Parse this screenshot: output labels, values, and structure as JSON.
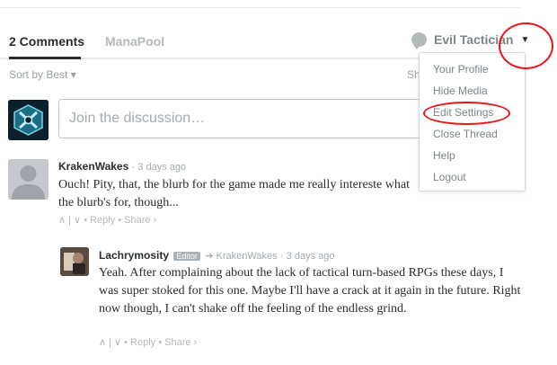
{
  "tabs": [
    {
      "label": "2 Comments"
    },
    {
      "label": "ManaPool"
    }
  ],
  "user": {
    "name": "Evil Tactician"
  },
  "sort": {
    "label": "Sort by Best ▾",
    "share_partial": "Sh"
  },
  "compose": {
    "placeholder": "Join the discussion…"
  },
  "menu": {
    "items": [
      {
        "label": "Your Profile"
      },
      {
        "label": "Hide Media"
      },
      {
        "label": "Edit Settings"
      },
      {
        "label": "Close Thread"
      },
      {
        "label": "Help"
      },
      {
        "label": "Logout"
      }
    ]
  },
  "comments": [
    {
      "author": "KrakenWakes",
      "time": "3 days ago",
      "body": "Ouch! Pity, that, the blurb for the game made me really intereste what the blurb's for, though...",
      "actions": "∧ | ∨ • Reply • Share ›"
    },
    {
      "author": "Lachrymosity",
      "badge": "Editor",
      "reply_to": "➔ KrakenWakes",
      "time": "3 days ago",
      "body": "Yeah. After complaining about the lack of tactical turn-based RPGs these days, I was super stoked for this one. Maybe I'll have a crack at it again in the future. Right now though, I can't shake off the feeling of the endless grind.",
      "actions": "∧ | ∨ • Reply • Share ›"
    }
  ],
  "colors": {
    "annotation": "#e8151b",
    "accent": "#2a2e2e",
    "muted": "#a3aab0"
  }
}
